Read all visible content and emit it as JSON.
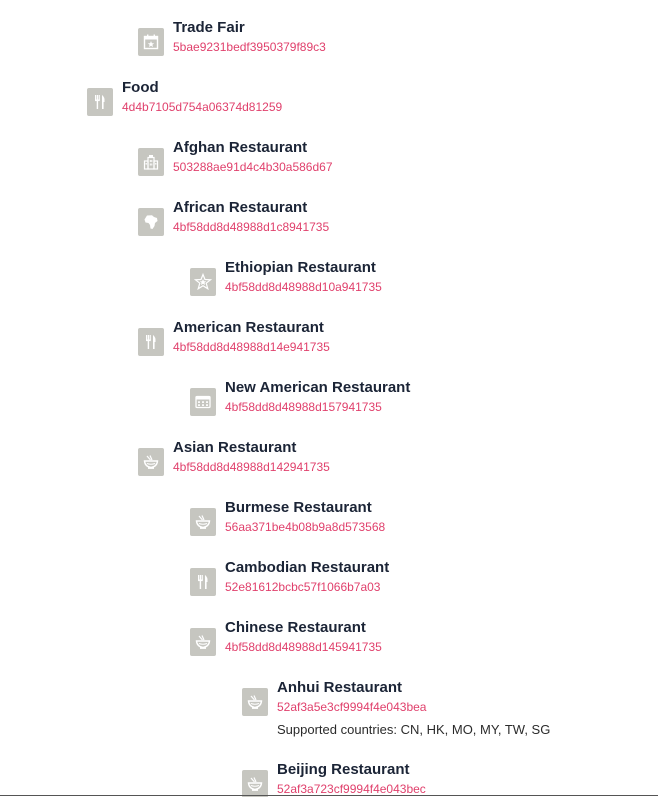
{
  "categories": [
    {
      "name": "Trade Fair",
      "id": "5bae9231bedf3950379f89c3",
      "icon": "calendar-star-icon"
    },
    {
      "name": "Food",
      "id": "4d4b7105d754a06374d81259",
      "icon": "fork-knife-icon"
    },
    {
      "name": "Afghan Restaurant",
      "id": "503288ae91d4c4b30a586d67",
      "icon": "building-icon"
    },
    {
      "name": "African Restaurant",
      "id": "4bf58dd8d48988d1c8941735",
      "icon": "africa-map-icon"
    },
    {
      "name": "Ethiopian Restaurant",
      "id": "4bf58dd8d48988d10a941735",
      "icon": "star-emblem-icon"
    },
    {
      "name": "American Restaurant",
      "id": "4bf58dd8d48988d14e941735",
      "icon": "fork-knife-icon"
    },
    {
      "name": "New American Restaurant",
      "id": "4bf58dd8d48988d157941735",
      "icon": "food-truck-icon"
    },
    {
      "name": "Asian Restaurant",
      "id": "4bf58dd8d48988d142941735",
      "icon": "noodle-bowl-icon"
    },
    {
      "name": "Burmese Restaurant",
      "id": "56aa371be4b08b9a8d573568",
      "icon": "noodle-bowl-icon"
    },
    {
      "name": "Cambodian Restaurant",
      "id": "52e81612bcbc57f1066b7a03",
      "icon": "fork-knife-icon"
    },
    {
      "name": "Chinese Restaurant",
      "id": "4bf58dd8d48988d145941735",
      "icon": "noodle-bowl-icon"
    },
    {
      "name": "Anhui Restaurant",
      "id": "52af3a5e3cf9994f4e043bea",
      "icon": "noodle-bowl-icon",
      "countries": "Supported countries: CN, HK, MO, MY, TW, SG"
    },
    {
      "name": "Beijing Restaurant",
      "id": "52af3a723cf9994f4e043bec",
      "icon": "noodle-bowl-icon"
    }
  ]
}
